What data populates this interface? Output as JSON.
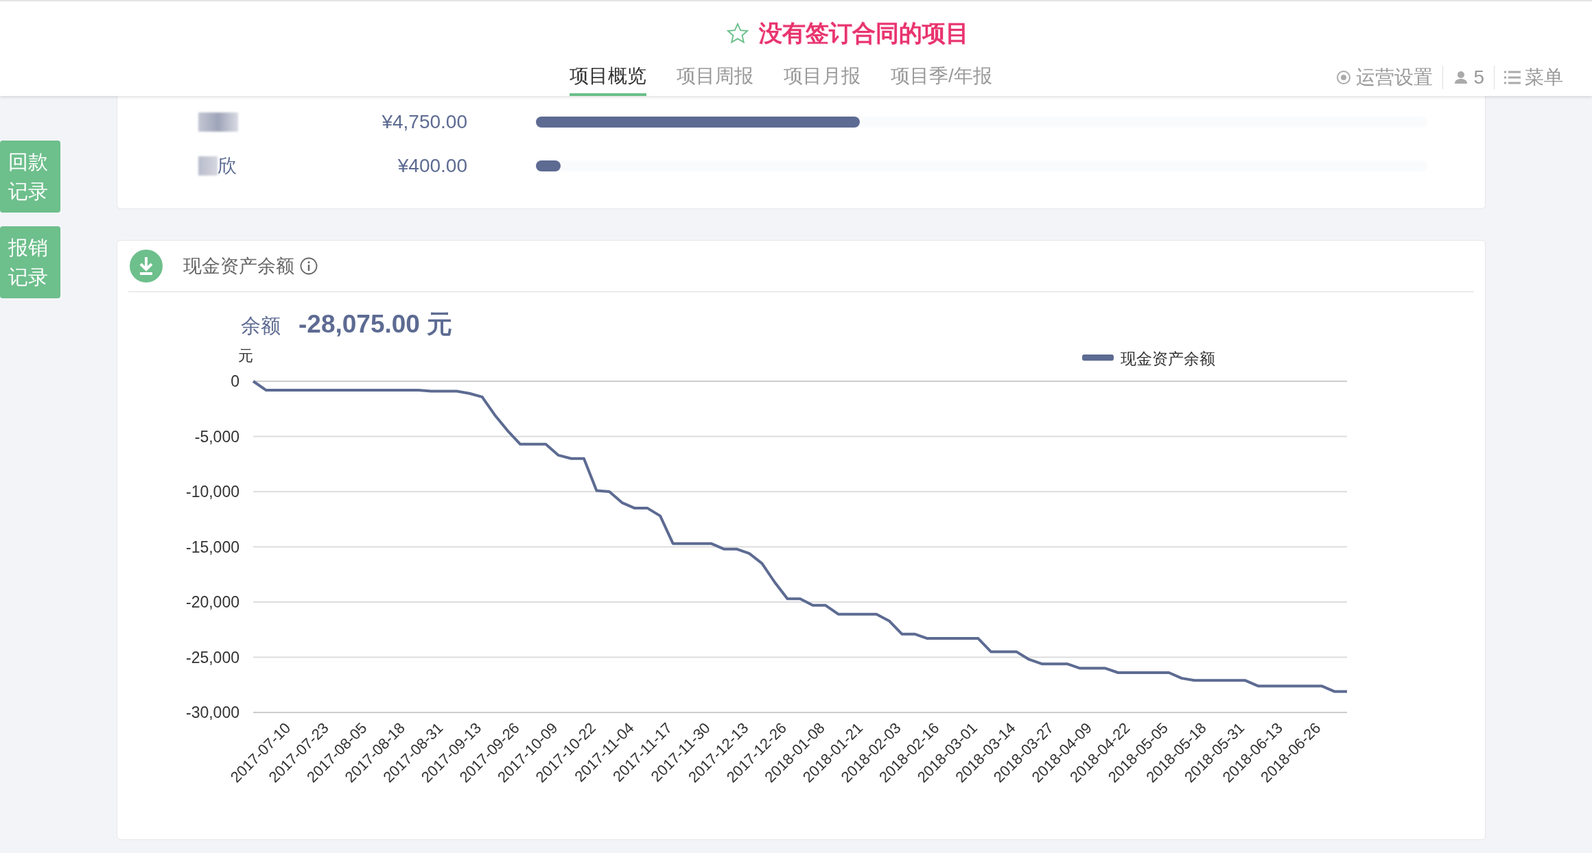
{
  "header": {
    "title": "没有签订合同的项目",
    "tabs": [
      {
        "label": "项目概览",
        "selected": true
      },
      {
        "label": "项目周报",
        "selected": false
      },
      {
        "label": "项目月报",
        "selected": false
      },
      {
        "label": "项目季/年报",
        "selected": false
      }
    ],
    "actions": [
      {
        "kind": "settings",
        "label": "运营设置"
      },
      {
        "kind": "members",
        "label": "5"
      },
      {
        "kind": "menu",
        "label": "菜单"
      }
    ]
  },
  "side_buttons": [
    "回款记录",
    "报销记录"
  ],
  "payee_list": {
    "rows": [
      {
        "amount": "¥4,750.00",
        "level": 0.363
      },
      {
        "name": "欣",
        "amount": "¥400.00",
        "level": 0.028
      }
    ]
  },
  "cash_balance": {
    "title": "现金资产余额",
    "balance_label": "余额",
    "balance_value": "-28,075.00 元",
    "chart_data": {
      "type": "line",
      "ylabel": "元",
      "categories": [
        null,
        null,
        null,
        "2017-07-10",
        null,
        null,
        "2017-07-23",
        null,
        null,
        "2017-08-05",
        null,
        null,
        "2017-08-18",
        null,
        null,
        "2017-08-31",
        null,
        null,
        "2017-09-13",
        null,
        null,
        "2017-09-26",
        null,
        null,
        "2017-10-09",
        null,
        null,
        "2017-10-22",
        null,
        null,
        "2017-11-04",
        null,
        null,
        "2017-11-17",
        null,
        null,
        "2017-11-30",
        null,
        null,
        "2017-12-13",
        null,
        null,
        "2017-12-26",
        null,
        null,
        "2018-01-08",
        null,
        null,
        "2018-01-21",
        null,
        null,
        "2018-02-03",
        null,
        null,
        "2018-02-16",
        null,
        null,
        "2018-03-01",
        null,
        null,
        "2018-03-14",
        null,
        null,
        "2018-03-27",
        null,
        null,
        "2018-04-09",
        null,
        null,
        "2018-04-22",
        null,
        null,
        "2018-05-05",
        null,
        null,
        "2018-05-18",
        null,
        null,
        "2018-05-31",
        null,
        null,
        "2018-06-13",
        null,
        null,
        "2018-06-26",
        null,
        null
      ],
      "series": [
        {
          "name": "现金资产余额",
          "color": "#5d6b92",
          "values": [
            0,
            -800,
            -800,
            -800,
            -800,
            -800,
            -800,
            -800,
            -800,
            -800,
            -800,
            -800,
            -800,
            -800,
            -900,
            -900,
            -900,
            -1100,
            -1420,
            -3070,
            -4480,
            -5700,
            -5700,
            -5700,
            -6700,
            -7000,
            -7000,
            -9900,
            -10000,
            -11000,
            -11500,
            -11500,
            -12200,
            -14700,
            -14700,
            -14700,
            -14700,
            -15200,
            -15200,
            -15600,
            -16500,
            -18200,
            -19700,
            -19700,
            -20300,
            -20300,
            -21100,
            -21100,
            -21100,
            -21100,
            -21700,
            -22900,
            -22900,
            -23300,
            -23300,
            -23300,
            -23300,
            -23300,
            -24500,
            -24500,
            -24500,
            -25200,
            -25600,
            -25600,
            -25600,
            -26000,
            -26000,
            -26000,
            -26400,
            -26400,
            -26400,
            -26400,
            -26400,
            -26900,
            -27100,
            -27100,
            -27100,
            -27100,
            -27100,
            -27600,
            -27600,
            -27600,
            -27600,
            -27600,
            -27600,
            -28100,
            -28100
          ]
        }
      ],
      "ylim": [
        -30000,
        0
      ],
      "grid": true,
      "yticks": [
        {
          "value": 0,
          "label": "0"
        },
        {
          "value": -5000,
          "label": "-5,000"
        },
        {
          "value": -10000,
          "label": "-10,000"
        },
        {
          "value": -15000,
          "label": "-15,000"
        },
        {
          "value": -20000,
          "label": "-20,000"
        },
        {
          "value": -25000,
          "label": "-25,000"
        },
        {
          "value": -30000,
          "label": "-30,000"
        }
      ]
    }
  }
}
